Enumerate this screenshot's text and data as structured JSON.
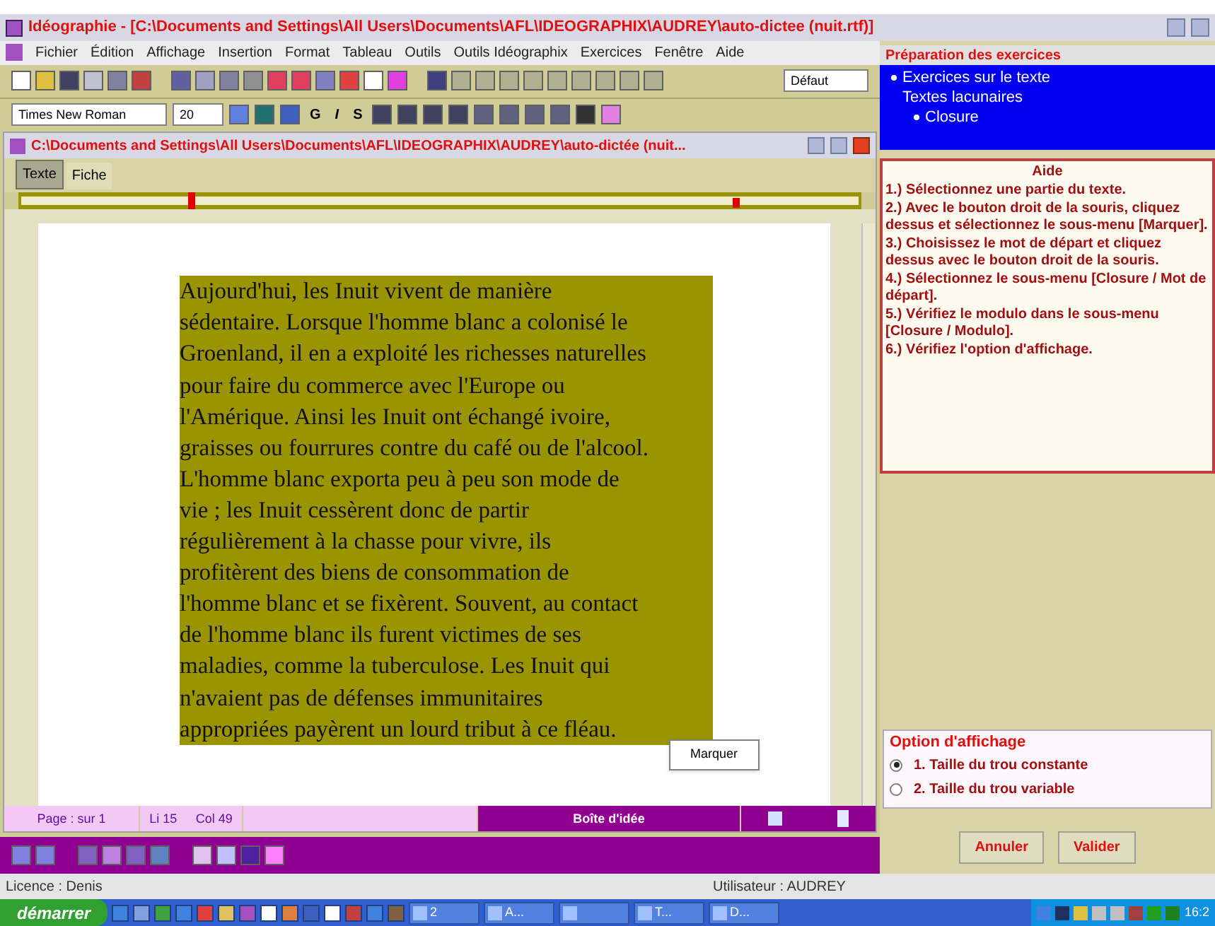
{
  "window": {
    "title": "Idéographie - [C:\\Documents and Settings\\All Users\\Documents\\AFL\\IDEOGRAPHIX\\AUDREY\\auto-dictee (nuit.rtf)]"
  },
  "menu": [
    "Fichier",
    "Édition",
    "Affichage",
    "Insertion",
    "Format",
    "Tableau",
    "Outils",
    "Outils Idéographix",
    "Exercices",
    "Fenêtre",
    "Aide"
  ],
  "toolbar": {
    "style": "Défaut",
    "font": "Times New Roman",
    "size": "20",
    "format_buttons": [
      "G",
      "I",
      "S"
    ]
  },
  "document": {
    "title": "C:\\Documents and Settings\\All Users\\Documents\\AFL\\IDEOGRAPHIX\\AUDREY\\auto-dictée (nuit...",
    "tabs": [
      {
        "label": "Texte",
        "selected": true
      },
      {
        "label": "Fiche",
        "selected": false
      }
    ],
    "lines": [
      "Aujourd'hui, les Inuit vivent de manière",
      "sédentaire. Lorsque l'homme blanc a colonisé le",
      "Groenland, il en a exploité les richesses naturelles",
      "pour faire du commerce avec l'Europe ou",
      "l'Amérique. Ainsi les Inuit ont échangé ivoire,",
      "graisses ou fourrures contre du café ou de l'alcool.",
      "L'homme blanc exporta peu à peu son mode de",
      "vie ; les Inuit cessèrent donc de partir",
      "régulièrement à la chasse pour vivre, ils",
      "profitèrent des biens de consommation de",
      "l'homme blanc et se fixèrent. Souvent, au contact",
      "de l'homme blanc ils furent victimes de ses",
      "maladies, comme la tuberculose. Les Inuit qui",
      "n'avaient pas de défenses immunitaires",
      "appropriées payèrent un lourd tribut à ce fléau."
    ],
    "context_menu": [
      "Marquer"
    ],
    "status": {
      "page": "Page : sur 1",
      "line": "Li 15",
      "column": "Col 49",
      "idea_box": "Boîte d'idée"
    }
  },
  "panel": {
    "title": "Préparation des exercices",
    "tree": [
      {
        "label": "Exercices sur le texte",
        "bullet": true,
        "children": [
          {
            "label": "Textes lacunaires",
            "bullet": false,
            "children": [
              {
                "label": "Closure",
                "bullet": true
              }
            ]
          }
        ]
      }
    ],
    "help": {
      "title": "Aide",
      "steps": [
        "1.) Sélectionnez une partie du texte.",
        "2.) Avec le bouton droit de la souris, cliquez dessus et sélectionnez le sous-menu [Marquer].",
        "3.) Choisissez le mot de départ et cliquez dessus avec le bouton droit de la souris.",
        "4.) Sélectionnez le sous-menu [Closure / Mot de départ].",
        "5.) Vérifiez le modulo dans le sous-menu [Closure / Modulo].",
        "6.) Vérifiez l'option d'affichage."
      ]
    },
    "options": {
      "title": "Option d'affichage",
      "items": [
        {
          "label": "1. Taille du trou constante",
          "selected": true
        },
        {
          "label": "2. Taille du trou variable",
          "selected": false
        }
      ]
    },
    "buttons": [
      "Annuler",
      "Valider"
    ]
  },
  "footer": {
    "license": "Licence : Denis",
    "user": "Utilisateur : AUDREY"
  },
  "taskbar": {
    "start": "démarrer",
    "tasks": [
      {
        "kind": "labeled",
        "label": "2"
      },
      {
        "kind": "labeled",
        "label": "A..."
      },
      {
        "kind": "icon_only"
      },
      {
        "kind": "labeled",
        "label": "T..."
      },
      {
        "kind": "labeled",
        "label": "D..."
      }
    ],
    "clock": "16:2"
  }
}
